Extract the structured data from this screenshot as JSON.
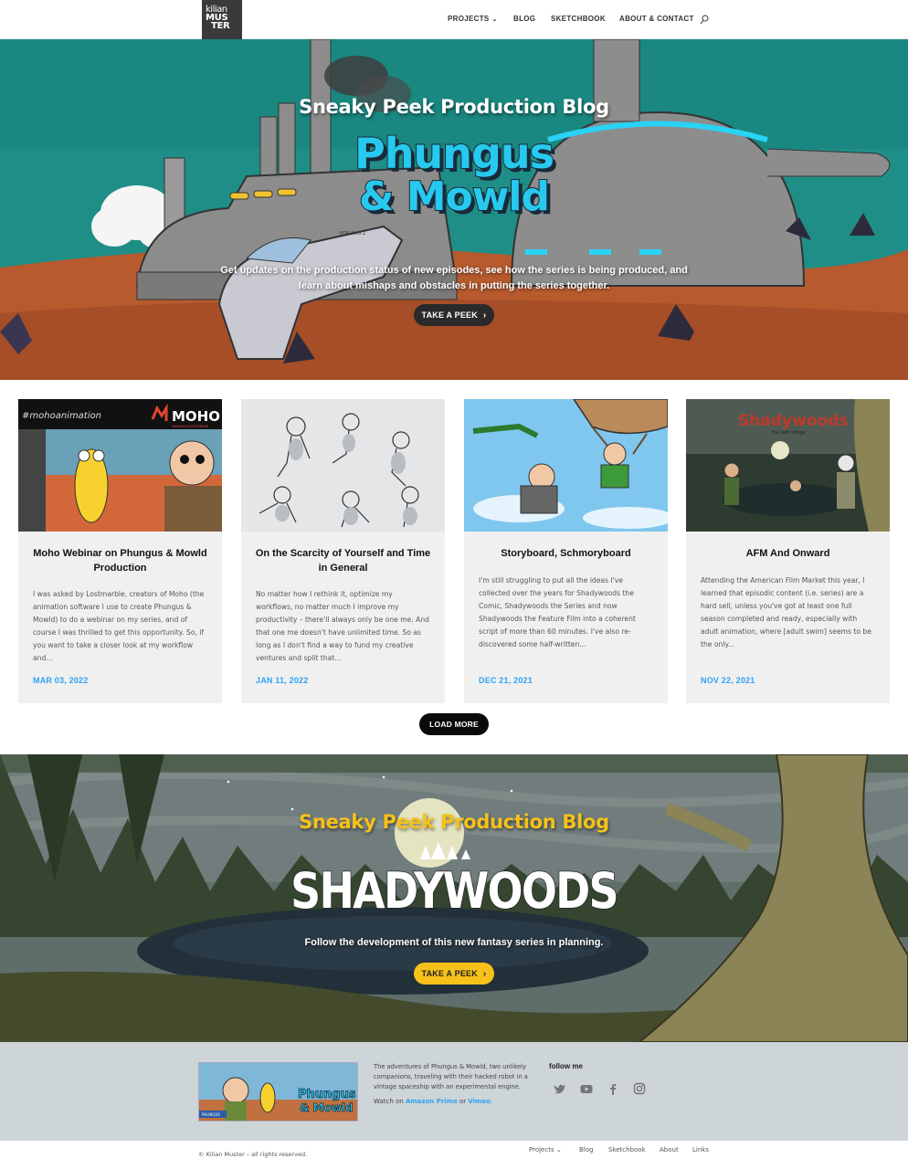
{
  "header": {
    "logo_line1": "kilian",
    "logo_line2": "MUS",
    "logo_line3": "TER",
    "nav": [
      {
        "label": "PROJECTS",
        "has_dropdown": true
      },
      {
        "label": "BLOG"
      },
      {
        "label": "SKETCHBOOK"
      },
      {
        "label": "ABOUT & CONTACT"
      }
    ],
    "dropdown_glyph": "⌄",
    "search_icon": "search-icon"
  },
  "hero1": {
    "subtitle": "Sneaky Peek Production Blog",
    "logo_line1": "Phungus",
    "logo_line2": "& Mowld",
    "description": "Get updates on the production status of new episodes, see how the series is being produced, and learn about mishaps and obstacles in putting the series together.",
    "button": "TAKE A PEEK",
    "ship_label": "PON KHO Z"
  },
  "posts": [
    {
      "title": "Moho Webinar on Phungus & Mowld Production",
      "excerpt": "I was asked by Lostmarble, creators of Moho (the animation software I use to create Phungus & Mowld) to do a webinar on my series, and of course I was thrilled to get this opportunity. So, if you want to take a closer look at my workflow and...",
      "date": "MAR 03, 2022",
      "thumb_caption": "#mohoanimation",
      "thumb_brand": "MOHO",
      "thumb_brand_sub": "ANIMATION SOFTWARE"
    },
    {
      "title": "On the Scarcity of Yourself and Time in General",
      "excerpt": "No matter how I rethink it, optimize my workflows, no matter much I improve my productivity – there'll always only be one me. And that one me doesn't have unlimited time. So as long as I don't find a way to fund my creative ventures and split that...",
      "date": "JAN 11, 2022"
    },
    {
      "title": "Storyboard, Schmoryboard",
      "excerpt": "I'm still struggling to put all the ideas I've collected over the years for Shadywoods the Comic, Shadywoods the Series and now Shadywoods the Feature Film into a coherent script of more than 60 minutes. I've also re-discovered some half-written...",
      "date": "DEC 21, 2021"
    },
    {
      "title": "AFM And Onward",
      "excerpt": "Attending the American Film Market this year, I learned that episodic content (i.e. series) are a hard sell, unless you've got at least one full season completed and ready, especially with adult animation, where [adult swim] seems to be the only...",
      "date": "NOV 22, 2021",
      "thumb_brand": "Shadywoods",
      "thumb_brand_sub": "the last refuge"
    }
  ],
  "load_more": "LOAD MORE",
  "hero2": {
    "subtitle": "Sneaky Peek Production Blog",
    "logo": "SHADYWOODS",
    "description": "Follow the development of this new fantasy series in planning.",
    "button": "TAKE A PEEK"
  },
  "footer": {
    "image_badge": "PHUNGUS",
    "image_logo_line1": "Phungus",
    "image_logo_line2": "& Mowld",
    "text": "The adventures of Phungus & Mowld, two unlikely companions, traveling with their hacked robot in a vintage spaceship with an experimental engine.",
    "watch_prefix": "Watch on ",
    "watch_link1": "Amazon Prime",
    "watch_or": " or ",
    "watch_link2": "Vimeo",
    "watch_suffix": ".",
    "follow": "follow me",
    "social": [
      "twitter-icon",
      "youtube-icon",
      "facebook-icon",
      "instagram-icon"
    ],
    "copyright": "© Kilian Muster – all rights reserved.",
    "nav": [
      "Projects",
      "Blog",
      "Sketchbook",
      "About",
      "Links"
    ],
    "nav_dropdown_glyph": "⌄"
  },
  "colors": {
    "accent_blue": "#2ea3f2",
    "cyan_logo": "#27c9ef",
    "yellow_button": "#f6c11a",
    "dark_button": "#2a2a2a",
    "footer_bg": "#cdd5d9"
  }
}
